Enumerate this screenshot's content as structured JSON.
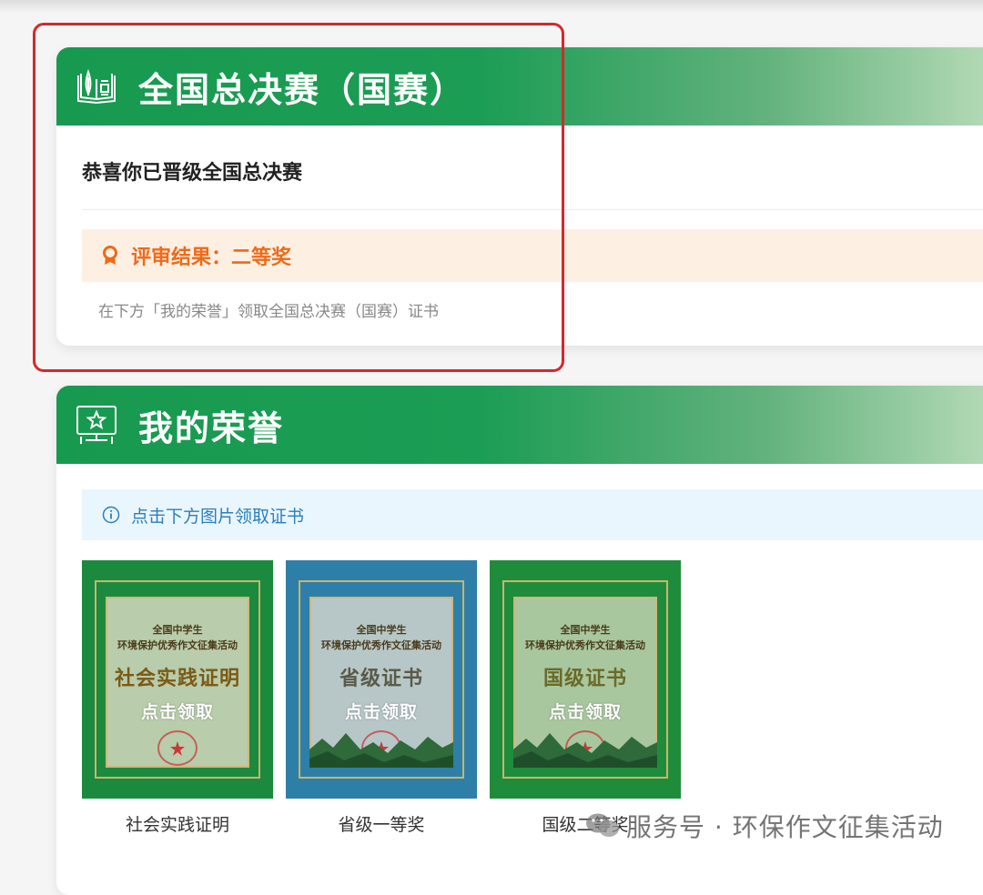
{
  "final_section": {
    "title": "全国总决赛（国赛）",
    "congrats": "恭喜你已晋级全国总决赛",
    "result": "评审结果：二等奖",
    "hint": "在下方「我的荣誉」领取全国总决赛（国赛）证书",
    "icon": "book-plant-icon"
  },
  "honor_section": {
    "title": "我的荣誉",
    "icon": "computer-star-icon",
    "info": "点击下方图片领取证书",
    "certificates": [
      {
        "org_line1": "全国中学生",
        "org_line2": "环境保护优秀作文征集活动",
        "title": "社会实践证明",
        "claim": "点击领取",
        "caption": "社会实践证明"
      },
      {
        "org_line1": "全国中学生",
        "org_line2": "环境保护优秀作文征集活动",
        "title": "省级证书",
        "claim": "点击领取",
        "caption": "省级一等奖"
      },
      {
        "org_line1": "全国中学生",
        "org_line2": "环境保护优秀作文征集活动",
        "title": "国级证书",
        "claim": "点击领取",
        "caption": "国级二等奖"
      }
    ]
  },
  "watermark": "服务号 · 环保作文征集活动",
  "colors": {
    "header_green": "#179a4f",
    "result_orange": "#ee6a1a",
    "info_blue": "#2a7fc0",
    "highlight_red": "#d9262c"
  }
}
